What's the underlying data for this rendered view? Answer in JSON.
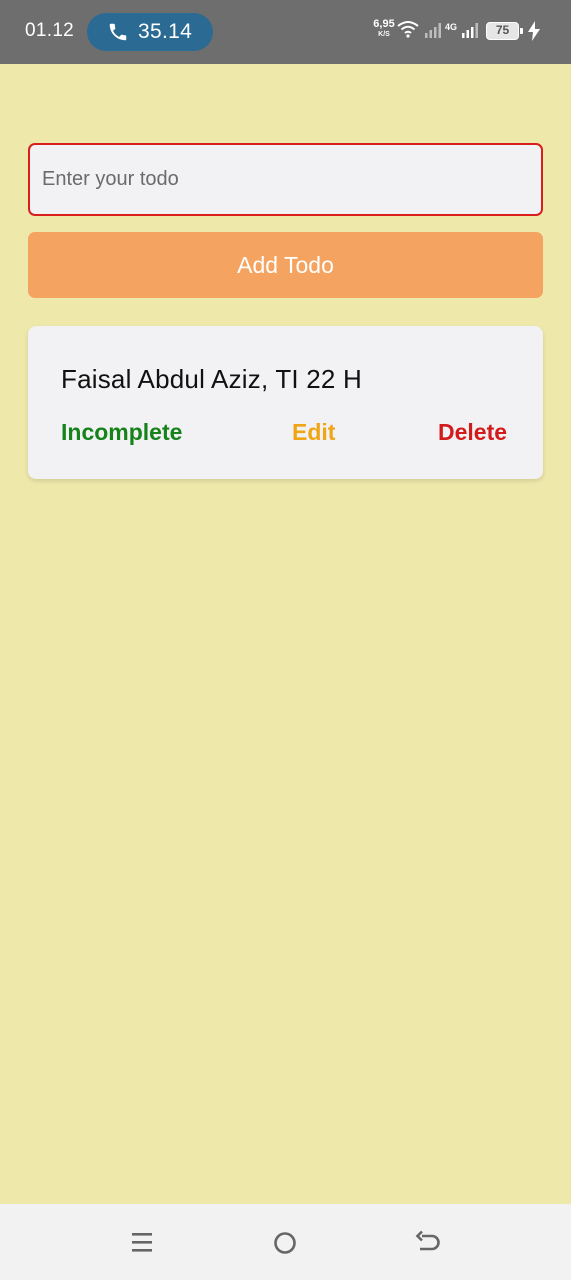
{
  "status_bar": {
    "time": "01.12",
    "call_duration": "35.14",
    "net_speed_value": "6,95",
    "net_speed_unit": "K/S",
    "network_type": "4G",
    "battery_level": "75",
    "icons": [
      "phone-icon",
      "wifi-icon",
      "signal-icon",
      "battery-icon",
      "charging-icon"
    ]
  },
  "form": {
    "input_placeholder": "Enter your todo",
    "input_value": "",
    "add_button_label": "Add Todo"
  },
  "todos": [
    {
      "text": "Faisal Abdul Aziz, TI 22 H",
      "complete_label": "Incomplete",
      "edit_label": "Edit",
      "delete_label": "Delete"
    }
  ],
  "nav_bar": {
    "buttons": [
      "menu-icon",
      "home-icon",
      "back-icon"
    ]
  },
  "colors": {
    "background": "#EEE8AA",
    "input_border": "#D91E1E",
    "add_button": "#F4A460",
    "incomplete": "#16821A",
    "edit": "#F0A516",
    "delete": "#D41B1B"
  }
}
